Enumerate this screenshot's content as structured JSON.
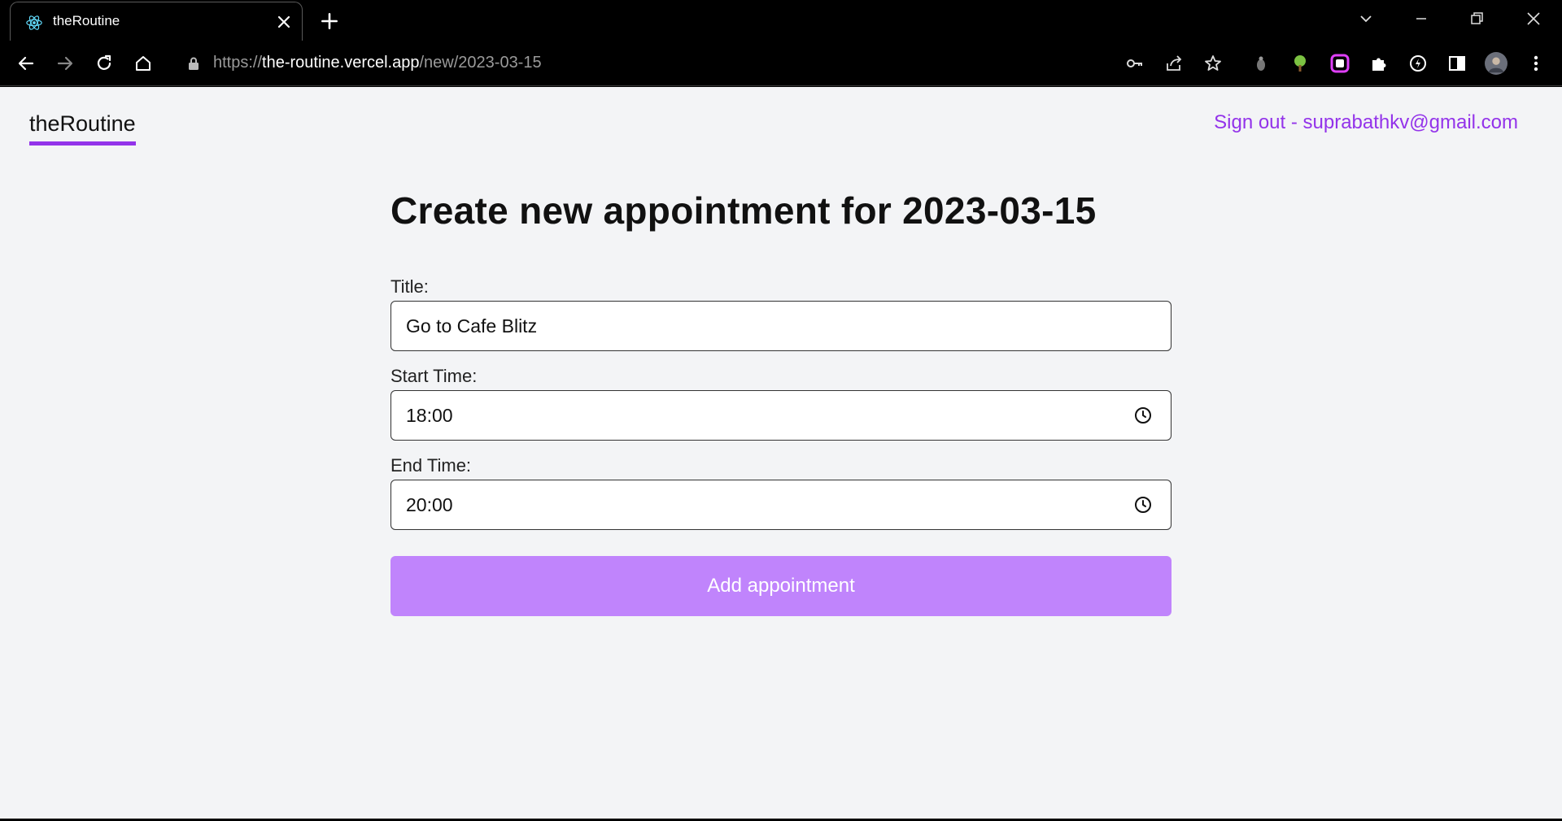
{
  "browser": {
    "tab_title": "theRoutine",
    "url_scheme": "https://",
    "url_host": "the-routine.vercel.app",
    "url_path": "/new/2023-03-15"
  },
  "header": {
    "brand": "theRoutine",
    "signout_label": "Sign out - suprabathkv@gmail.com"
  },
  "form": {
    "heading": "Create new appointment for 2023-03-15",
    "title_label": "Title:",
    "title_value": "Go to Cafe Blitz",
    "start_label": "Start Time:",
    "start_value": "18:00",
    "end_label": "End Time:",
    "end_value": "20:00",
    "submit_label": "Add appointment"
  },
  "colors": {
    "accent": "#9333ea",
    "button": "#c084fc",
    "page_bg": "#f3f4f6"
  }
}
